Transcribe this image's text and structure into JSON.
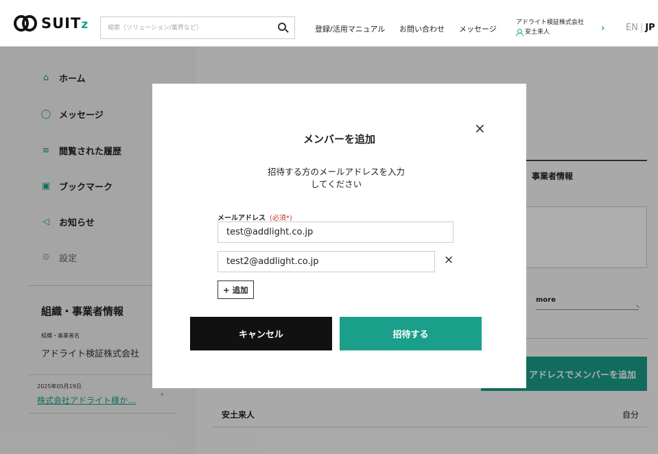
{
  "header": {
    "logo_text": "SUIT",
    "logo_z": "z",
    "search_placeholder": "検索（ソリューション/業界など）",
    "nav": [
      "登録/活用マニュアル",
      "お問い合わせ",
      "メッセージ"
    ],
    "company": "アドライト検証株式会社",
    "user": "安土来人",
    "lang_en": "EN",
    "lang_sep": "|",
    "lang_jp": "JP"
  },
  "sidebar": {
    "items": [
      {
        "label": "ホーム",
        "icon": "home-icon"
      },
      {
        "label": "メッセージ",
        "icon": "speech-bubble-icon"
      },
      {
        "label": "閲覧された履歴",
        "icon": "list-icon"
      },
      {
        "label": "ブックマーク",
        "icon": "bookmark-icon"
      },
      {
        "label": "お知らせ",
        "icon": "megaphone-icon"
      },
      {
        "label": "設定",
        "icon": "gear-icon"
      }
    ],
    "org_title": "組織・事業者情報",
    "org_label": "組織・事業者名",
    "org_name": "アドライト検証株式会社",
    "news_date": "2025年05月19日",
    "news_link": "株式会社アドライト様か…"
  },
  "main": {
    "biz_info": "事業者情報",
    "more": "more",
    "add_by_email": "アドレスでメンバーを追加",
    "member_name": "安土来人",
    "member_self": "自分"
  },
  "modal": {
    "close": "×",
    "title": "メンバーを追加",
    "desc": "招待する方のメールアドレスを入力してください",
    "field_label": "メールアドレス",
    "required": "(必須*)",
    "emails": [
      "test@addlight.co.jp",
      "test2@addlight.co.jp"
    ],
    "remove": "×",
    "add_row": "+ 追加",
    "cancel": "キャンセル",
    "invite": "招待する"
  },
  "colors": {
    "accent": "#1aa08a",
    "dark_button": "#111111",
    "required": "#c0392b"
  }
}
